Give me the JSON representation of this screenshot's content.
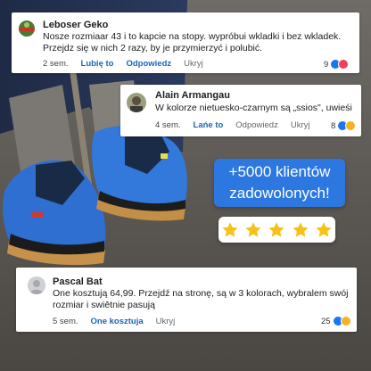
{
  "comments": [
    {
      "author": "Leboser Geko",
      "text_line1": "Nosze rozmiaar 43 i to kapcie na stopy. wypróbui wkladki i bez wkladek.",
      "text_line2": "Przejdz się w nich 2 razy, by je przymierzyć i polubić.",
      "time": "2 sem.",
      "like": "Lubię to",
      "reply": "Odpowiedz",
      "hide": "Ukryj",
      "reactions_count": "9"
    },
    {
      "author": "Alain Armangau",
      "text_line1": "W kolorze nietuesko-czarnym są „ssios\", uwieśi",
      "time": "4 sem.",
      "like": "Lańe to",
      "reply": "Odpowiedz",
      "hide": "Ukryj",
      "reactions_count": "8"
    },
    {
      "author": "Pascal Bat",
      "text_line1": "One kosztują 64,99. Przejdź na stronę, są w 3 kolorach, wybralem swój",
      "text_line2": "rozmiar i swiētnie pasują",
      "time": "5 sem.",
      "like": "One kosztuja",
      "hide": "Ukryj",
      "reactions_count": "25"
    }
  ],
  "promo": {
    "line1": "+5000 klientów",
    "line2": "zadowolonych!",
    "rating": 5
  },
  "colors": {
    "accent_blue": "#1b66b8",
    "promo_blue": "#2d78e0",
    "star_yellow": "#f6c21a"
  }
}
